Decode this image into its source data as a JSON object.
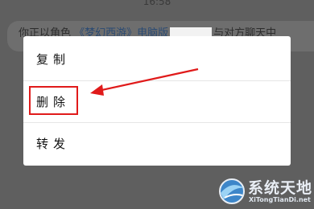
{
  "status_bar": {
    "time": "16:58"
  },
  "chat": {
    "text_prefix": "你正以角色",
    "link_text": "《梦幻西游》电脑版",
    "text_suffix": "与对方聊天中"
  },
  "context_menu": {
    "items": [
      {
        "label": "复制"
      },
      {
        "label": "删除"
      },
      {
        "label": "转发"
      }
    ]
  },
  "annotation": {
    "highlight_color": "#e01a1a",
    "highlighted_item": "删除"
  },
  "watermark": {
    "title": "系统天地",
    "url": "XiTongTianDi.net"
  },
  "colors": {
    "overlay": "#5f5f5f",
    "menu_bg": "#ffffff",
    "accent_red": "#e01a1a"
  }
}
